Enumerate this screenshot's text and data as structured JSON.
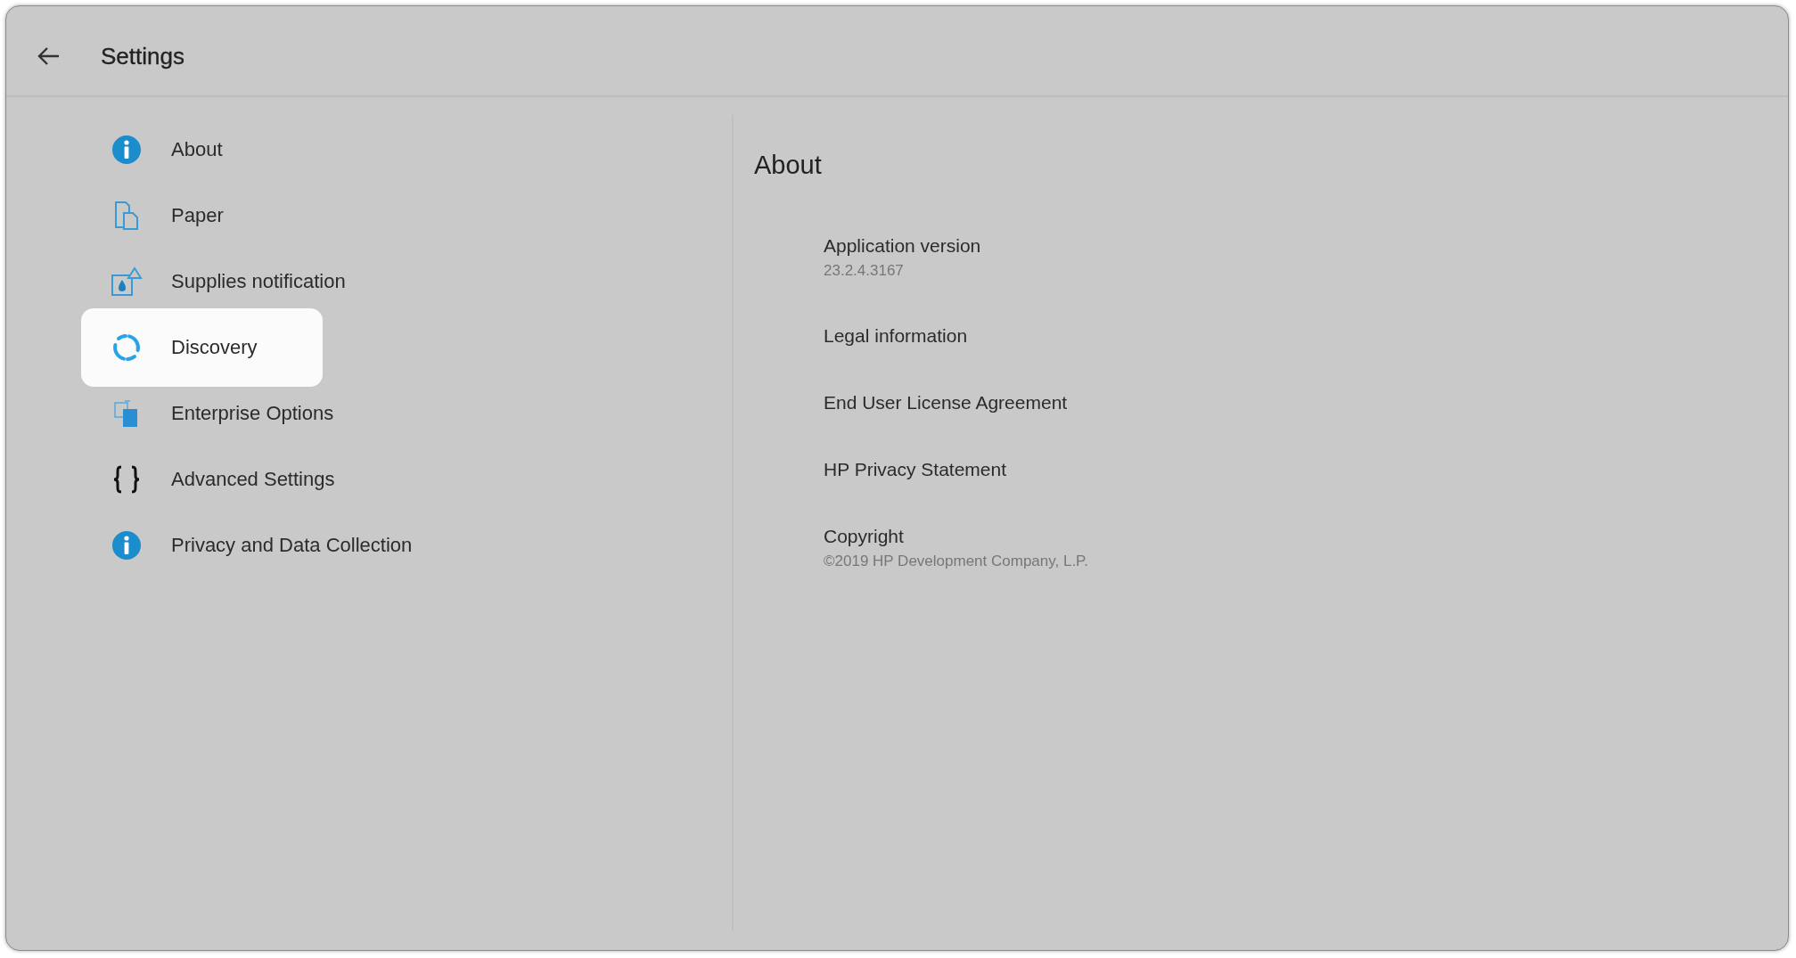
{
  "window": {
    "title": "Settings"
  },
  "sidebar": {
    "items": [
      {
        "label": "About",
        "kind": "info",
        "selected": false
      },
      {
        "label": "Paper",
        "kind": "paper",
        "selected": false
      },
      {
        "label": "Supplies notification",
        "kind": "supplies",
        "selected": false
      },
      {
        "label": "Discovery",
        "kind": "discovery",
        "selected": true
      },
      {
        "label": "Enterprise Options",
        "kind": "enterprise",
        "selected": false
      },
      {
        "label": "Advanced Settings",
        "kind": "braces",
        "selected": false
      },
      {
        "label": "Privacy and Data Collection",
        "kind": "info",
        "selected": false
      }
    ]
  },
  "detail": {
    "heading": "About",
    "entries": [
      {
        "title": "Application version",
        "value": "23.2.4.3167"
      },
      {
        "title": "Legal information"
      },
      {
        "title": "End User License Agreement"
      },
      {
        "title": "HP Privacy Statement"
      },
      {
        "title": "Copyright",
        "value": "©2019 HP Development Company, L.P."
      }
    ]
  }
}
